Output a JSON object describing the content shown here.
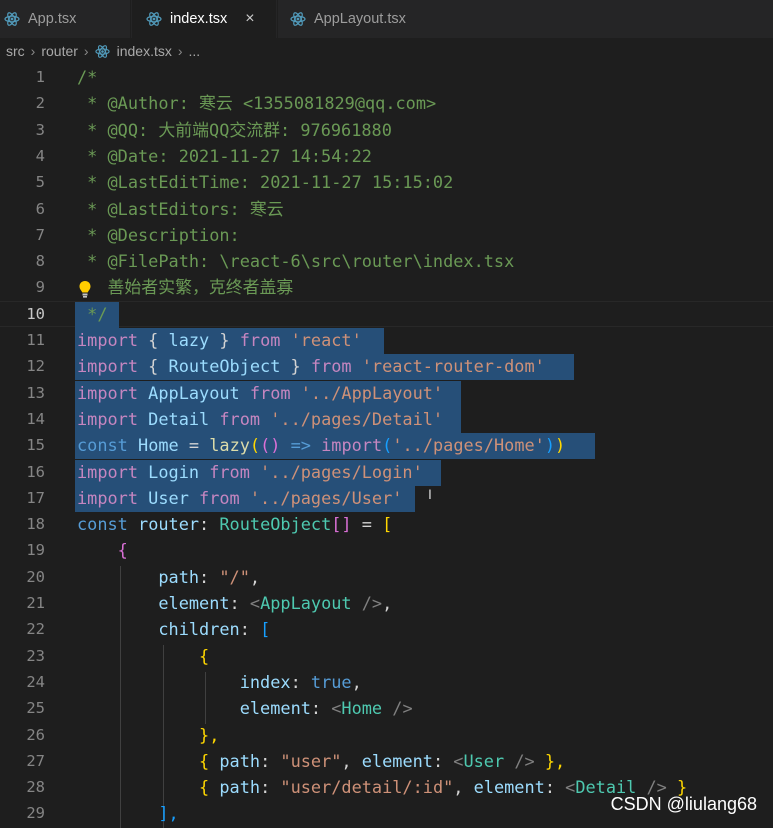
{
  "tabs": [
    {
      "label": "App.tsx"
    },
    {
      "label": "index.tsx",
      "close": "×"
    },
    {
      "label": "AppLayout.tsx"
    }
  ],
  "breadcrumb": {
    "items": [
      "src",
      "router"
    ],
    "file": "index.tsx",
    "ellipsis": "..."
  },
  "line_numbers": [
    "1",
    "2",
    "3",
    "4",
    "5",
    "6",
    "7",
    "8",
    "9",
    "10",
    "11",
    "12",
    "13",
    "14",
    "15",
    "16",
    "17",
    "18",
    "19",
    "20",
    "21",
    "22",
    "23",
    "24",
    "25",
    "26",
    "27",
    "28",
    "29"
  ],
  "code": {
    "l1": "/*",
    "l2": " * @Author: 寒云 <1355081829@qq.com>",
    "l3": " * @QQ: 大前端QQ交流群: 976961880",
    "l4": " * @Date: 2021-11-27 14:54:22",
    "l5": " * @LastEditTime: 2021-11-27 15:15:02",
    "l6": " * @LastEditors: 寒云",
    "l7": " * @Description: ",
    "l8": " * @FilePath: \\react-6\\src\\router\\index.tsx",
    "l9": "   善始者实繁，克终者盖寡",
    "l10": " */",
    "l11": {
      "kw": "import",
      "b1": " { ",
      "name": "lazy",
      "b2": " } ",
      "from": "from",
      "src": " 'react'"
    },
    "l12": {
      "kw": "import",
      "b1": " { ",
      "name": "RouteObject",
      "b2": " } ",
      "from": "from",
      "src": " 'react-router-dom'"
    },
    "l13": {
      "kw": "import",
      "name": " AppLayout ",
      "from": "from",
      "src": " '../AppLayout'"
    },
    "l14": {
      "kw": "import",
      "name": " Detail ",
      "from": "from",
      "src": " '../pages/Detail'"
    },
    "l15": {
      "kw": "const",
      "name": " Home",
      "eq": " = ",
      "fn": "lazy",
      "p1": "(",
      "p2": "()",
      "arrow": " => ",
      "imp": "import",
      "p3": "(",
      "src": "'../pages/Home'",
      "p4": ")",
      "p5": ")"
    },
    "l16": {
      "kw": "import",
      "name": " Login ",
      "from": "from",
      "src": " '../pages/Login'"
    },
    "l17": {
      "kw": "import",
      "name": " User ",
      "from": "from",
      "src": " '../pages/User'"
    },
    "l18": {
      "kw": "const",
      "name": " router",
      "colon": ": ",
      "type": "RouteObject",
      "br": "[]",
      "eq": " = ",
      "open": "["
    },
    "l19": "    {",
    "l20": {
      "indent": "        ",
      "prop": "path",
      "colon": ": ",
      "val": "\"/\"",
      "comma": ","
    },
    "l21": {
      "indent": "        ",
      "prop": "element",
      "colon": ": ",
      "lt": "<",
      "tag": "AppLayout",
      "end": " />",
      "comma": ","
    },
    "l22": {
      "indent": "        ",
      "prop": "children",
      "colon": ": ",
      "open": "["
    },
    "l23": "            {",
    "l24": {
      "indent": "                ",
      "prop": "index",
      "colon": ": ",
      "val": "true",
      "comma": ","
    },
    "l25": {
      "indent": "                ",
      "prop": "element",
      "colon": ": ",
      "lt": "<",
      "tag": "Home",
      "end": " />"
    },
    "l26": "            },",
    "l27": {
      "indent": "            ",
      "o": "{",
      "prop": " path",
      "colon": ": ",
      "val": "\"user\"",
      "comma": ", ",
      "prop2": "element",
      "colon2": ": ",
      "lt": "<",
      "tag": "User",
      "end": " />",
      "close": " },"
    },
    "l28": {
      "indent": "            ",
      "o": "{",
      "prop": " path",
      "colon": ": ",
      "val": "\"user/detail/:id\"",
      "comma": ", ",
      "prop2": "element",
      "colon2": ": ",
      "lt": "<",
      "tag": "Detail",
      "end": " />",
      "close": " }"
    },
    "l29": "        ],"
  },
  "watermark": "CSDN @liulang68",
  "colors": {
    "background": "#1e1e1e",
    "selection": "#264f78",
    "comment": "#6a9955",
    "keyword": "#569cd6",
    "string": "#ce9178"
  }
}
